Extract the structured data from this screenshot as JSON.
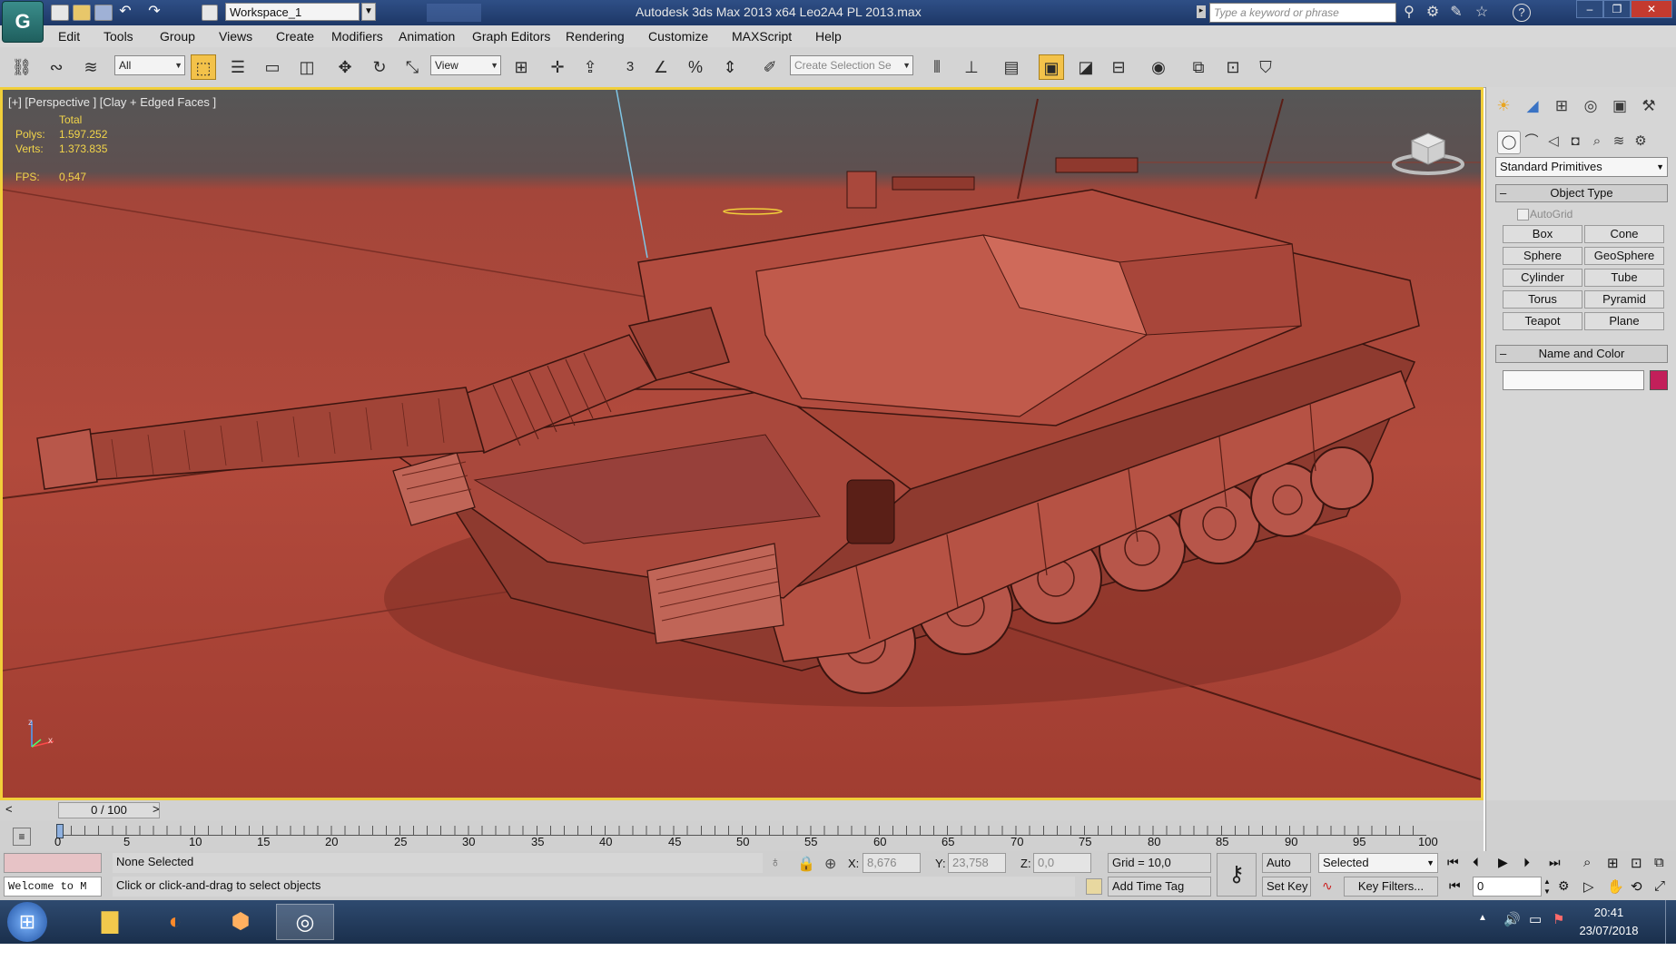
{
  "titlebar": {
    "logo_text": "G",
    "workspace": "Workspace_1",
    "title": "Autodesk 3ds Max  2013 x64      Leo2A4 PL 2013.max",
    "search_placeholder": "Type a keyword or phrase",
    "help_icon": "?",
    "minimize": "‒",
    "maximize": "❐",
    "close": "✕"
  },
  "menu": [
    "Edit",
    "Tools",
    "Group",
    "Views",
    "Create",
    "Modifiers",
    "Animation",
    "Graph Editors",
    "Rendering",
    "Customize",
    "MAXScript",
    "Help"
  ],
  "toolbar": {
    "filter": "All",
    "ref_coord": "View",
    "snap_number": "3",
    "selection_set_placeholder": "Create Selection Se"
  },
  "viewport": {
    "label": "[+] [Perspective ] [Clay + Edged Faces ]",
    "stats_header": "Total",
    "polys_label": "Polys:",
    "polys_value": "1.597.252",
    "verts_label": "Verts:",
    "verts_value": "1.373.835",
    "fps_label": "FPS:",
    "fps_value": "0,547",
    "axis_x": "x",
    "axis_z": "z"
  },
  "command_panel": {
    "primitive_type": "Standard Primitives",
    "object_type_title": "Object Type",
    "autogrid": "AutoGrid",
    "buttons": [
      "Box",
      "Cone",
      "Sphere",
      "GeoSphere",
      "Cylinder",
      "Tube",
      "Torus",
      "Pyramid",
      "Teapot",
      "Plane"
    ],
    "name_color_title": "Name and Color",
    "object_color": "#c21f5a"
  },
  "timeline": {
    "frame": "0 / 100",
    "prev": "<",
    "next": ">",
    "ticks": [
      "0",
      "5",
      "10",
      "15",
      "20",
      "25",
      "30",
      "35",
      "40",
      "45",
      "50",
      "55",
      "60",
      "65",
      "70",
      "75",
      "80",
      "85",
      "90",
      "95",
      "100"
    ]
  },
  "status": {
    "selection": "None Selected",
    "prompt": "Click or click-and-drag to select objects",
    "maxscript": "Welcome to M",
    "x_label": "X:",
    "x_value": "8,676",
    "y_label": "Y:",
    "y_value": "23,758",
    "z_label": "Z:",
    "z_value": "0,0",
    "grid": "Grid = 10,0",
    "add_time_tag": "Add Time Tag",
    "auto_key": "Auto Key",
    "set_key": "Set Key",
    "selected": "Selected",
    "key_filters": "Key Filters...",
    "frame_field": "0"
  },
  "taskbar": {
    "time": "20:41",
    "date": "23/07/2018"
  },
  "colors": {
    "viewport_border": "#f1cf3a",
    "active_tool": "#f3c24a",
    "tank": "#b04a3d"
  }
}
